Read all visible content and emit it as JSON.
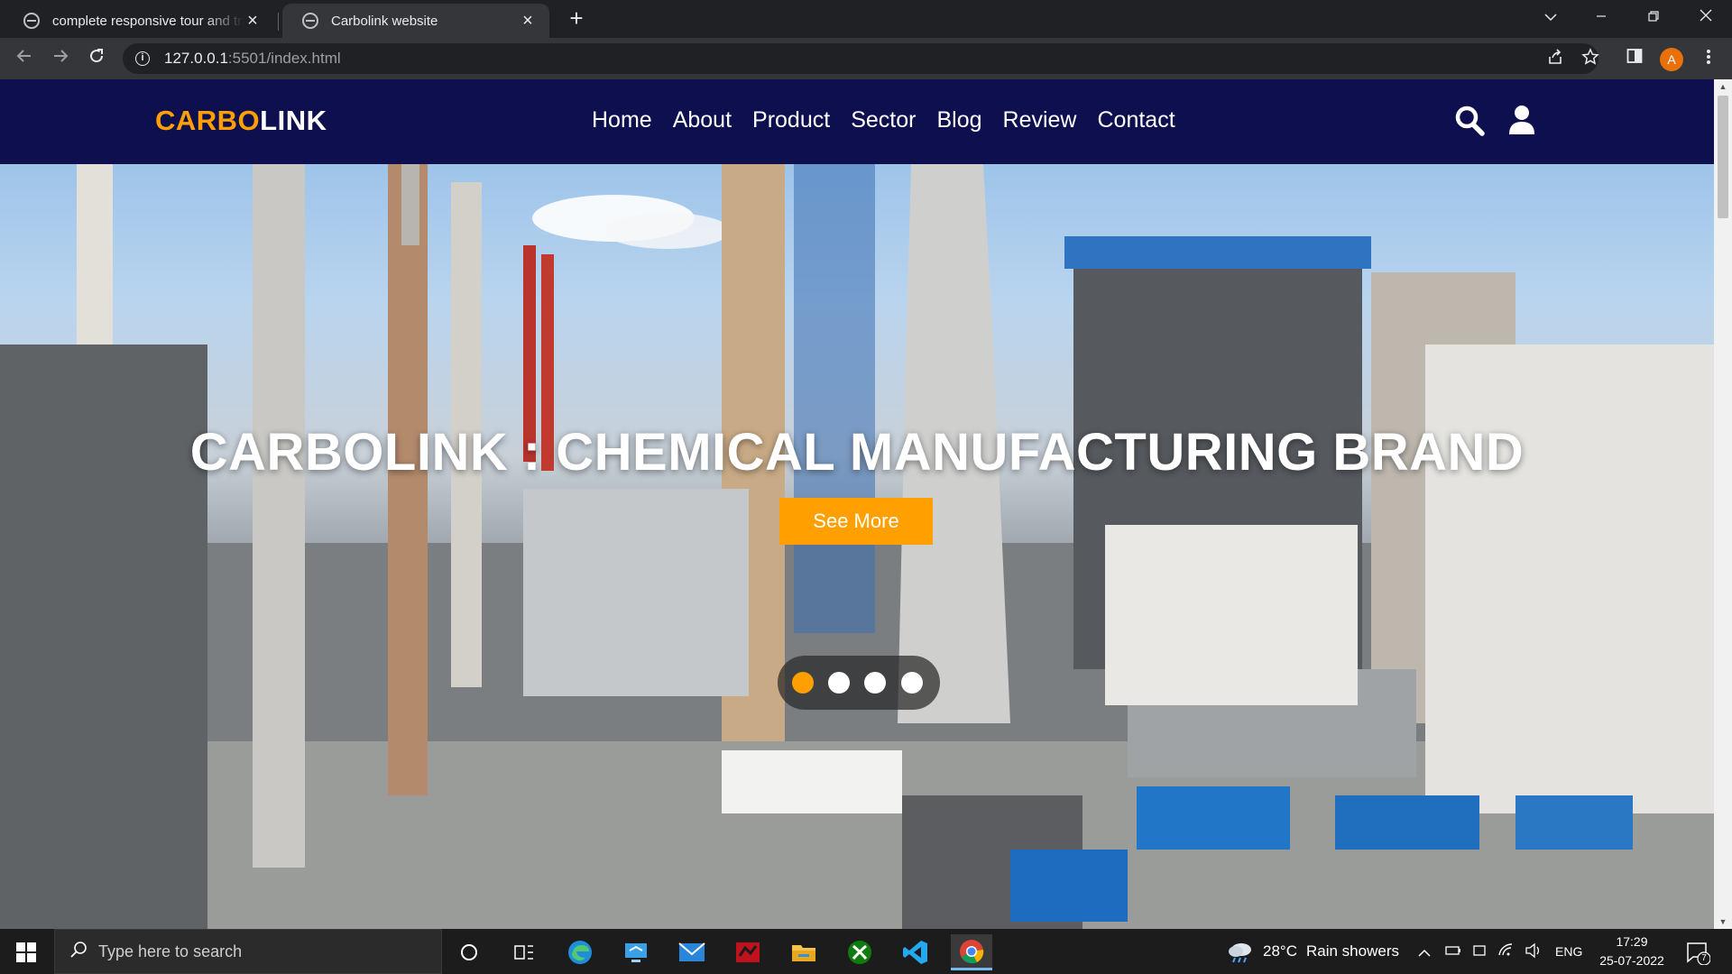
{
  "browser": {
    "tabs": [
      {
        "title": "complete responsive tour and tra",
        "active": false
      },
      {
        "title": "Carbolink website",
        "active": true
      }
    ],
    "address": {
      "host": "127.0.0.1",
      "rest": ":5501/index.html"
    }
  },
  "site": {
    "logo": {
      "part1": "CARBO",
      "part2": "LINK"
    },
    "nav": [
      "Home",
      "About",
      "Product",
      "Sector",
      "Blog",
      "Review",
      "Contact"
    ],
    "hero": {
      "title": "CARBOLINK : CHEMICAL MANUFACTURING BRAND",
      "button": "See More",
      "slide_count": 4,
      "active_slide": 1
    },
    "colors": {
      "header_bg": "#0e0f4f",
      "accent": "#ffa000",
      "text": "#ffffff"
    }
  },
  "taskbar": {
    "search_placeholder": "Type here to search",
    "weather": {
      "temp": "28°C",
      "condition": "Rain showers"
    },
    "language": "ENG",
    "time": "17:29",
    "date": "25-07-2022",
    "notifications": "7",
    "apps": [
      "cortana-icon",
      "task-view-icon",
      "edge-icon",
      "remote-desktop-icon",
      "mail-icon",
      "media-app-icon",
      "file-explorer-icon",
      "xbox-icon",
      "vscode-icon",
      "chrome-icon"
    ]
  }
}
